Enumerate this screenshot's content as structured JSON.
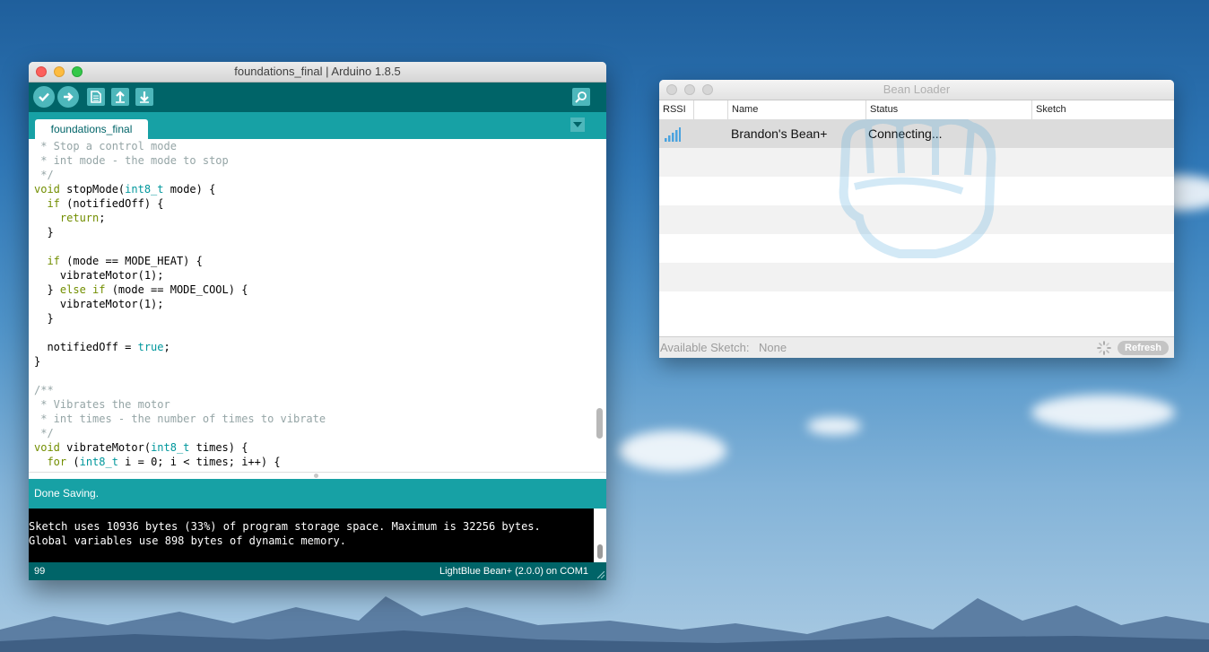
{
  "arduino": {
    "window_title": "foundations_final | Arduino 1.8.5",
    "tab_label": "foundations_final",
    "code_lines": [
      [
        {
          "t": " * Stop a control mode",
          "c": "c-comment"
        }
      ],
      [
        {
          "t": " * int mode - the mode to stop",
          "c": "c-comment"
        }
      ],
      [
        {
          "t": " */",
          "c": "c-comment"
        }
      ],
      [
        {
          "t": "void",
          "c": "c-kw"
        },
        {
          "t": " stopMode(",
          "c": ""
        },
        {
          "t": "int8_t",
          "c": "c-type"
        },
        {
          "t": " mode) {",
          "c": ""
        }
      ],
      [
        {
          "t": "  ",
          "c": ""
        },
        {
          "t": "if",
          "c": "c-ctl"
        },
        {
          "t": " (notifiedOff) {",
          "c": ""
        }
      ],
      [
        {
          "t": "    ",
          "c": ""
        },
        {
          "t": "return",
          "c": "c-ctl"
        },
        {
          "t": ";",
          "c": ""
        }
      ],
      [
        {
          "t": "  }",
          "c": ""
        }
      ],
      [
        {
          "t": "",
          "c": ""
        }
      ],
      [
        {
          "t": "  ",
          "c": ""
        },
        {
          "t": "if",
          "c": "c-ctl"
        },
        {
          "t": " (mode == MODE_HEAT) {",
          "c": ""
        }
      ],
      [
        {
          "t": "    vibrateMotor(1);",
          "c": ""
        }
      ],
      [
        {
          "t": "  } ",
          "c": ""
        },
        {
          "t": "else if",
          "c": "c-ctl"
        },
        {
          "t": " (mode == MODE_COOL) {",
          "c": ""
        }
      ],
      [
        {
          "t": "    vibrateMotor(1);",
          "c": ""
        }
      ],
      [
        {
          "t": "  }",
          "c": ""
        }
      ],
      [
        {
          "t": "",
          "c": ""
        }
      ],
      [
        {
          "t": "  notifiedOff = ",
          "c": ""
        },
        {
          "t": "true",
          "c": "c-lit"
        },
        {
          "t": ";",
          "c": ""
        }
      ],
      [
        {
          "t": "}",
          "c": ""
        }
      ],
      [
        {
          "t": "",
          "c": ""
        }
      ],
      [
        {
          "t": "/**",
          "c": "c-comment"
        }
      ],
      [
        {
          "t": " * Vibrates the motor",
          "c": "c-comment"
        }
      ],
      [
        {
          "t": " * int times - the number of times to vibrate",
          "c": "c-comment"
        }
      ],
      [
        {
          "t": " */",
          "c": "c-comment"
        }
      ],
      [
        {
          "t": "void",
          "c": "c-kw"
        },
        {
          "t": " vibrateMotor(",
          "c": ""
        },
        {
          "t": "int8_t",
          "c": "c-type"
        },
        {
          "t": " times) {",
          "c": ""
        }
      ],
      [
        {
          "t": "  ",
          "c": ""
        },
        {
          "t": "for",
          "c": "c-ctl"
        },
        {
          "t": " (",
          "c": ""
        },
        {
          "t": "int8_t",
          "c": "c-type"
        },
        {
          "t": " i = 0; i < times; i++) {",
          "c": ""
        }
      ]
    ],
    "status_message": "Done Saving.",
    "console_lines": [
      "Sketch uses 10936 bytes (33%) of program storage space. Maximum is 32256 bytes.",
      "Global variables use 898 bytes of dynamic memory."
    ],
    "line_number": "99",
    "board_info": "LightBlue Bean+ (2.0.0) on COM1",
    "colors": {
      "toolbar": "#006468",
      "accent": "#17a1a5",
      "button": "#4db7bb"
    }
  },
  "bean_loader": {
    "window_title": "Bean Loader",
    "columns": {
      "rssi": "RSSI",
      "name": "Name",
      "status": "Status",
      "sketch": "Sketch"
    },
    "devices": [
      {
        "name": "Brandon's Bean+",
        "status": "Connecting...",
        "sketch": ""
      }
    ],
    "available_label": "Available Sketch:",
    "available_value": "None",
    "refresh_label": "Refresh"
  }
}
